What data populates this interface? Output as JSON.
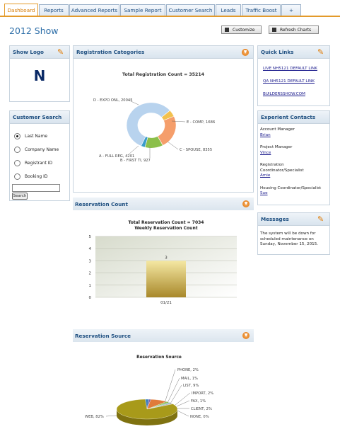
{
  "tabs": [
    "Dashboard",
    "Reports",
    "Advanced Reports",
    "Sample Report",
    "Customer Search",
    "Leads",
    "Traffic Boost",
    "+"
  ],
  "page_title": "2012 Show",
  "buttons": {
    "customize": "Customize",
    "refresh": "Refresh Charts"
  },
  "show_logo": {
    "title": "Show Logo",
    "logo_text": "N"
  },
  "customer_search": {
    "title": "Customer Search",
    "options": [
      "Last Name",
      "Company Name",
      "Registrant ID",
      "Booking ID"
    ],
    "selected": "Last Name",
    "input_value": "",
    "search_label": "Search"
  },
  "registration": {
    "title": "Registration Categories",
    "chart_title": "Total Registration Count = 35214",
    "labels": [
      "D - EXPO ONL, 20045",
      "E - COMP, 1686",
      "C - SPOUSE, 8355",
      "A - FULL REG, 4201",
      "B - FIRST TI, 927"
    ]
  },
  "reservation_count": {
    "title": "Reservation Count",
    "chart_title": "Total Reservation Count = 7034",
    "chart_subtitle": "Weekly Reservation Count",
    "bar_label": "3",
    "x_tick": "01/21",
    "y_ticks": [
      "5",
      "4",
      "3",
      "2",
      "1",
      "0"
    ]
  },
  "reservation_source": {
    "title": "Reservation Source",
    "chart_title": "Reservation Source",
    "labels": [
      "PHONE, 2%",
      "MAIL, 1%",
      "LIST, 9%",
      "IMPORT, 2%",
      "FAX, 1%",
      "CLIENT, 2%",
      "NONE, 0%",
      "WEB, 82%"
    ]
  },
  "quick_links": {
    "title": "Quick Links",
    "links": [
      "LIVE NH5121 DEFAULT LINK",
      "QA NH5121 DEFAULT LINK",
      "BUILDERSSHOW.COM"
    ]
  },
  "contacts": {
    "title": "Experient Contacts",
    "items": [
      {
        "role": "Account Manager",
        "name": "Brian"
      },
      {
        "role": "Project Manager",
        "name": "Vince"
      },
      {
        "role": "Registration Coordinator/Specialist",
        "name": "Amie"
      },
      {
        "role": "Housing Coordinator/Specialist",
        "name": "Sue"
      }
    ]
  },
  "messages": {
    "title": "Messages",
    "text": "The system will be down for scheduled maintenance on Sunday, November 15, 2015."
  },
  "chart_data": [
    {
      "type": "pie",
      "title": "Total Registration Count = 35214",
      "categories": [
        "D - EXPO ONL",
        "E - COMP",
        "C - SPOUSE",
        "A - FULL REG",
        "B - FIRST TI"
      ],
      "values": [
        20045,
        1686,
        8355,
        4201,
        927
      ]
    },
    {
      "type": "bar",
      "title": "Total Reservation Count = 7034",
      "subtitle": "Weekly Reservation Count",
      "categories": [
        "01/21"
      ],
      "values": [
        3
      ],
      "ylim": [
        0,
        5
      ]
    },
    {
      "type": "pie",
      "title": "Reservation Source",
      "categories": [
        "PHONE",
        "MAIL",
        "LIST",
        "IMPORT",
        "FAX",
        "CLIENT",
        "NONE",
        "WEB"
      ],
      "values": [
        2,
        1,
        9,
        2,
        1,
        2,
        0,
        82
      ]
    }
  ],
  "colors": {
    "tab_active": "#d67a00",
    "accent": "#2d6ea8",
    "bar": "#c9ad49"
  }
}
